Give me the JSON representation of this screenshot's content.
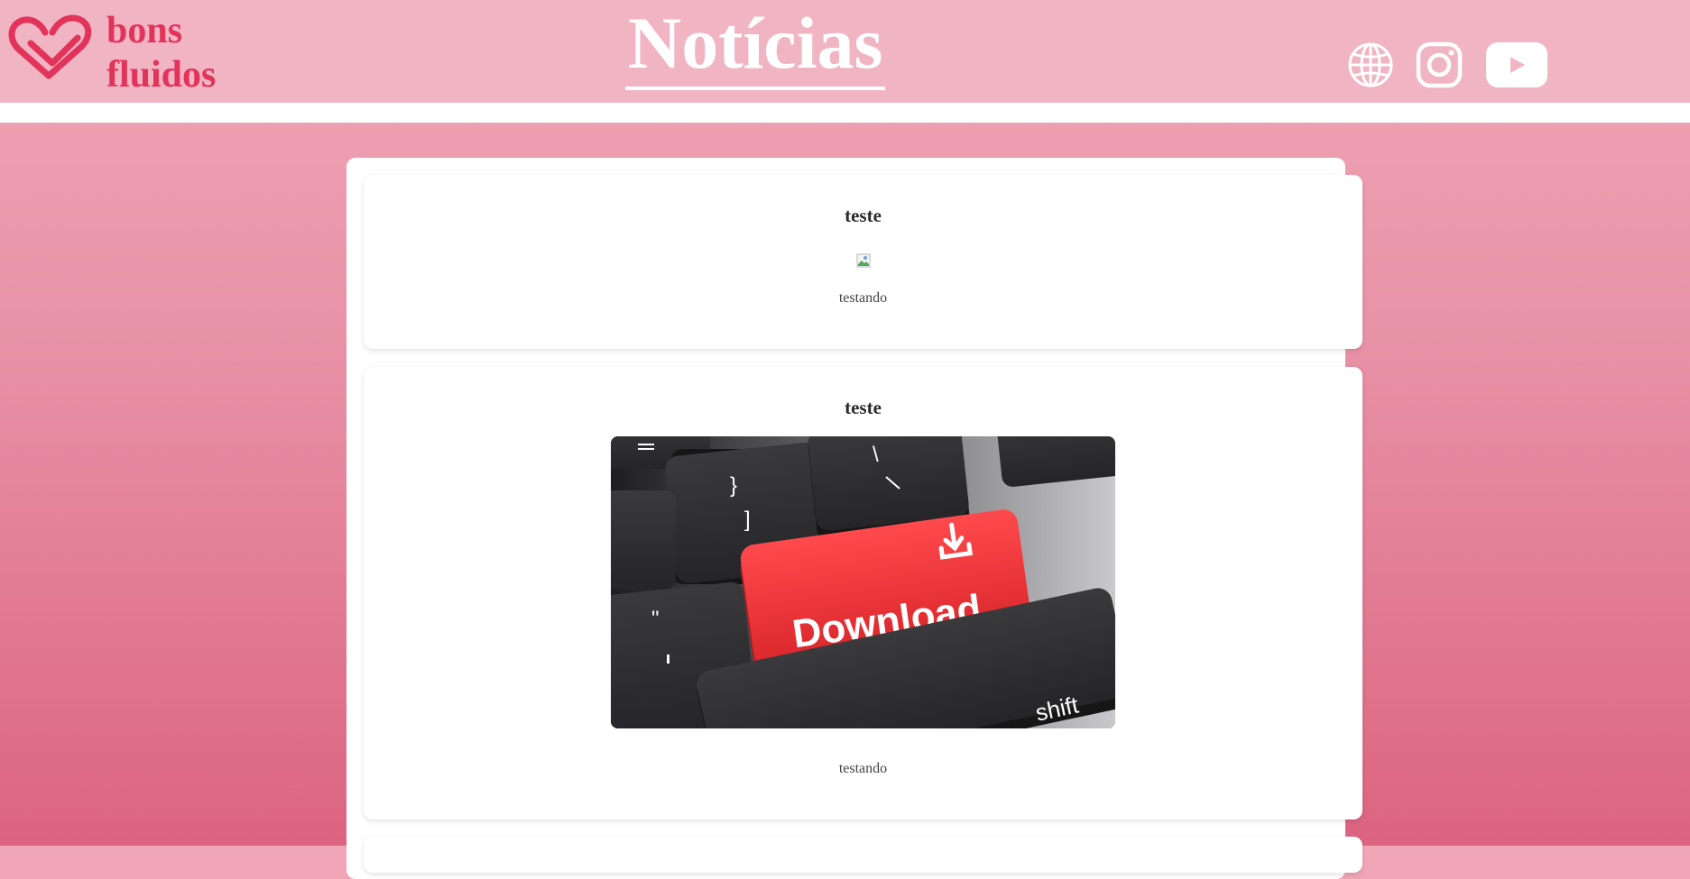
{
  "header": {
    "brand_line1": "bons",
    "brand_line2": "fluidos",
    "title": "Notícias",
    "logo_icon": "heart-logo-icon",
    "social_icons": [
      "globe-icon",
      "instagram-icon",
      "youtube-icon"
    ]
  },
  "posts": [
    {
      "title": "teste",
      "image": "broken-image-icon",
      "body": "testando"
    },
    {
      "title": "teste",
      "image": "keyboard-download-key-image",
      "image_key_label": "Download",
      "image_shift_label": "shift",
      "body": "testando"
    }
  ],
  "colors": {
    "header_bg": "#f1b4c3",
    "brand": "#e2335a",
    "page_gradient_top": "#f0a7b7",
    "page_gradient_bottom": "#dc6480",
    "card_bg": "#ffffff"
  }
}
